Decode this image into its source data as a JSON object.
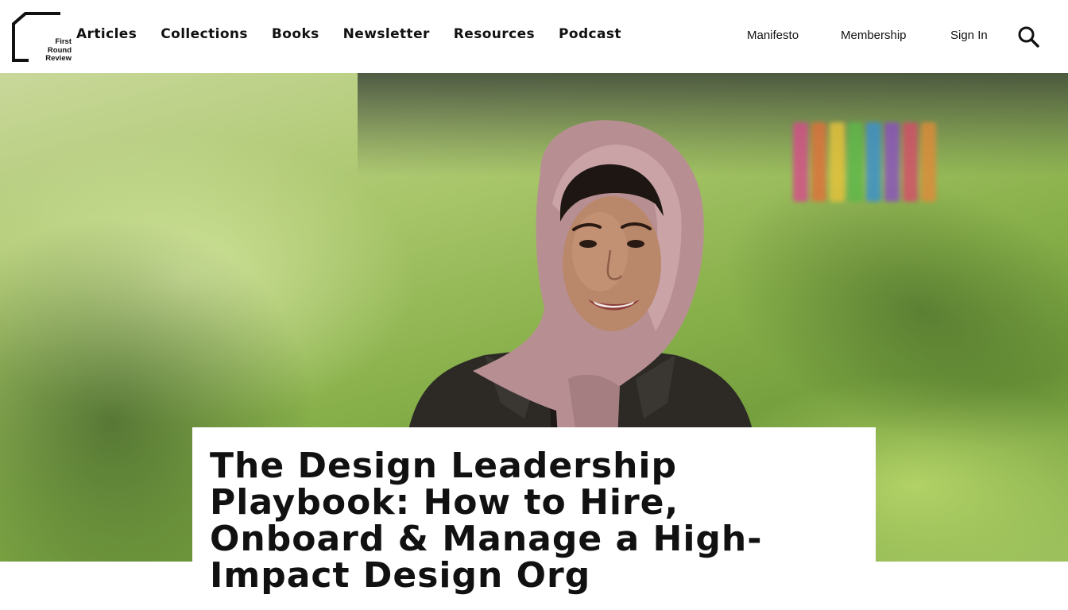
{
  "brand": {
    "logo_lines": [
      "First",
      "Round",
      "Review"
    ]
  },
  "nav": {
    "primary": [
      "Articles",
      "Collections",
      "Books",
      "Newsletter",
      "Resources",
      "Podcast"
    ],
    "secondary": [
      "Manifesto",
      "Membership",
      "Sign In"
    ],
    "search_icon": "search-icon"
  },
  "hero": {
    "image": "portrait-photo",
    "title": "The Design Leadership Playbook: How to Hire, Onboard & Manage a High-Impact Design Org"
  },
  "colors": {
    "text": "#111111",
    "background": "#ffffff",
    "grass": "#88b04a"
  }
}
